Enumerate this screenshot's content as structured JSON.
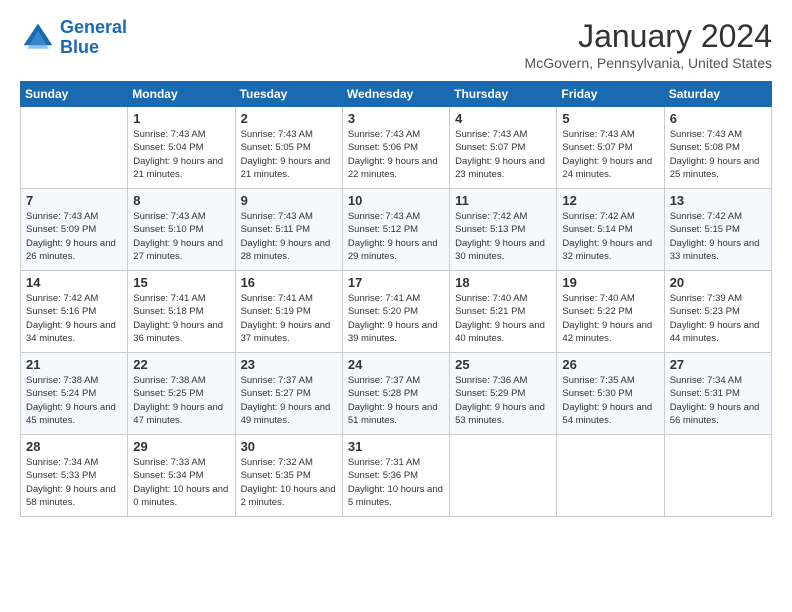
{
  "logo": {
    "line1": "General",
    "line2": "Blue"
  },
  "title": "January 2024",
  "subtitle": "McGovern, Pennsylvania, United States",
  "days_of_week": [
    "Sunday",
    "Monday",
    "Tuesday",
    "Wednesday",
    "Thursday",
    "Friday",
    "Saturday"
  ],
  "weeks": [
    [
      {
        "num": "",
        "sunrise": "",
        "sunset": "",
        "daylight": ""
      },
      {
        "num": "1",
        "sunrise": "Sunrise: 7:43 AM",
        "sunset": "Sunset: 5:04 PM",
        "daylight": "Daylight: 9 hours and 21 minutes."
      },
      {
        "num": "2",
        "sunrise": "Sunrise: 7:43 AM",
        "sunset": "Sunset: 5:05 PM",
        "daylight": "Daylight: 9 hours and 21 minutes."
      },
      {
        "num": "3",
        "sunrise": "Sunrise: 7:43 AM",
        "sunset": "Sunset: 5:06 PM",
        "daylight": "Daylight: 9 hours and 22 minutes."
      },
      {
        "num": "4",
        "sunrise": "Sunrise: 7:43 AM",
        "sunset": "Sunset: 5:07 PM",
        "daylight": "Daylight: 9 hours and 23 minutes."
      },
      {
        "num": "5",
        "sunrise": "Sunrise: 7:43 AM",
        "sunset": "Sunset: 5:07 PM",
        "daylight": "Daylight: 9 hours and 24 minutes."
      },
      {
        "num": "6",
        "sunrise": "Sunrise: 7:43 AM",
        "sunset": "Sunset: 5:08 PM",
        "daylight": "Daylight: 9 hours and 25 minutes."
      }
    ],
    [
      {
        "num": "7",
        "sunrise": "Sunrise: 7:43 AM",
        "sunset": "Sunset: 5:09 PM",
        "daylight": "Daylight: 9 hours and 26 minutes."
      },
      {
        "num": "8",
        "sunrise": "Sunrise: 7:43 AM",
        "sunset": "Sunset: 5:10 PM",
        "daylight": "Daylight: 9 hours and 27 minutes."
      },
      {
        "num": "9",
        "sunrise": "Sunrise: 7:43 AM",
        "sunset": "Sunset: 5:11 PM",
        "daylight": "Daylight: 9 hours and 28 minutes."
      },
      {
        "num": "10",
        "sunrise": "Sunrise: 7:43 AM",
        "sunset": "Sunset: 5:12 PM",
        "daylight": "Daylight: 9 hours and 29 minutes."
      },
      {
        "num": "11",
        "sunrise": "Sunrise: 7:42 AM",
        "sunset": "Sunset: 5:13 PM",
        "daylight": "Daylight: 9 hours and 30 minutes."
      },
      {
        "num": "12",
        "sunrise": "Sunrise: 7:42 AM",
        "sunset": "Sunset: 5:14 PM",
        "daylight": "Daylight: 9 hours and 32 minutes."
      },
      {
        "num": "13",
        "sunrise": "Sunrise: 7:42 AM",
        "sunset": "Sunset: 5:15 PM",
        "daylight": "Daylight: 9 hours and 33 minutes."
      }
    ],
    [
      {
        "num": "14",
        "sunrise": "Sunrise: 7:42 AM",
        "sunset": "Sunset: 5:16 PM",
        "daylight": "Daylight: 9 hours and 34 minutes."
      },
      {
        "num": "15",
        "sunrise": "Sunrise: 7:41 AM",
        "sunset": "Sunset: 5:18 PM",
        "daylight": "Daylight: 9 hours and 36 minutes."
      },
      {
        "num": "16",
        "sunrise": "Sunrise: 7:41 AM",
        "sunset": "Sunset: 5:19 PM",
        "daylight": "Daylight: 9 hours and 37 minutes."
      },
      {
        "num": "17",
        "sunrise": "Sunrise: 7:41 AM",
        "sunset": "Sunset: 5:20 PM",
        "daylight": "Daylight: 9 hours and 39 minutes."
      },
      {
        "num": "18",
        "sunrise": "Sunrise: 7:40 AM",
        "sunset": "Sunset: 5:21 PM",
        "daylight": "Daylight: 9 hours and 40 minutes."
      },
      {
        "num": "19",
        "sunrise": "Sunrise: 7:40 AM",
        "sunset": "Sunset: 5:22 PM",
        "daylight": "Daylight: 9 hours and 42 minutes."
      },
      {
        "num": "20",
        "sunrise": "Sunrise: 7:39 AM",
        "sunset": "Sunset: 5:23 PM",
        "daylight": "Daylight: 9 hours and 44 minutes."
      }
    ],
    [
      {
        "num": "21",
        "sunrise": "Sunrise: 7:38 AM",
        "sunset": "Sunset: 5:24 PM",
        "daylight": "Daylight: 9 hours and 45 minutes."
      },
      {
        "num": "22",
        "sunrise": "Sunrise: 7:38 AM",
        "sunset": "Sunset: 5:25 PM",
        "daylight": "Daylight: 9 hours and 47 minutes."
      },
      {
        "num": "23",
        "sunrise": "Sunrise: 7:37 AM",
        "sunset": "Sunset: 5:27 PM",
        "daylight": "Daylight: 9 hours and 49 minutes."
      },
      {
        "num": "24",
        "sunrise": "Sunrise: 7:37 AM",
        "sunset": "Sunset: 5:28 PM",
        "daylight": "Daylight: 9 hours and 51 minutes."
      },
      {
        "num": "25",
        "sunrise": "Sunrise: 7:36 AM",
        "sunset": "Sunset: 5:29 PM",
        "daylight": "Daylight: 9 hours and 53 minutes."
      },
      {
        "num": "26",
        "sunrise": "Sunrise: 7:35 AM",
        "sunset": "Sunset: 5:30 PM",
        "daylight": "Daylight: 9 hours and 54 minutes."
      },
      {
        "num": "27",
        "sunrise": "Sunrise: 7:34 AM",
        "sunset": "Sunset: 5:31 PM",
        "daylight": "Daylight: 9 hours and 56 minutes."
      }
    ],
    [
      {
        "num": "28",
        "sunrise": "Sunrise: 7:34 AM",
        "sunset": "Sunset: 5:33 PM",
        "daylight": "Daylight: 9 hours and 58 minutes."
      },
      {
        "num": "29",
        "sunrise": "Sunrise: 7:33 AM",
        "sunset": "Sunset: 5:34 PM",
        "daylight": "Daylight: 10 hours and 0 minutes."
      },
      {
        "num": "30",
        "sunrise": "Sunrise: 7:32 AM",
        "sunset": "Sunset: 5:35 PM",
        "daylight": "Daylight: 10 hours and 2 minutes."
      },
      {
        "num": "31",
        "sunrise": "Sunrise: 7:31 AM",
        "sunset": "Sunset: 5:36 PM",
        "daylight": "Daylight: 10 hours and 5 minutes."
      },
      {
        "num": "",
        "sunrise": "",
        "sunset": "",
        "daylight": ""
      },
      {
        "num": "",
        "sunrise": "",
        "sunset": "",
        "daylight": ""
      },
      {
        "num": "",
        "sunrise": "",
        "sunset": "",
        "daylight": ""
      }
    ]
  ]
}
